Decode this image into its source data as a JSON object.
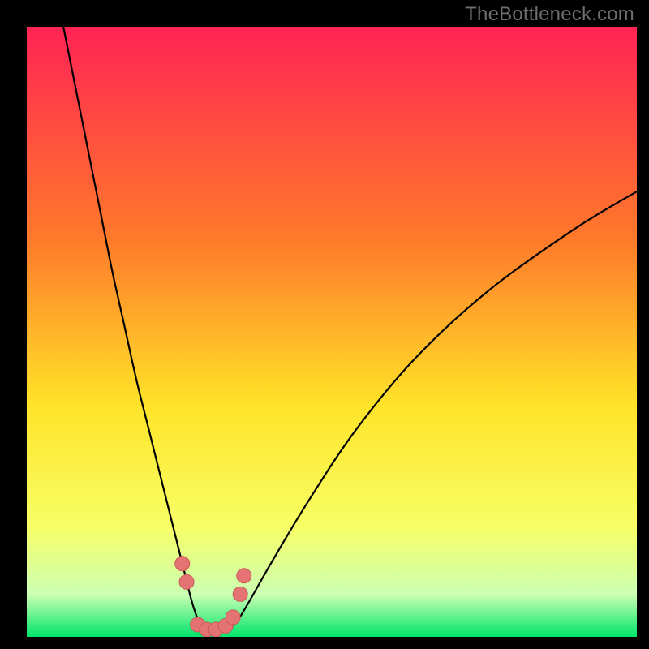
{
  "watermark": "TheBottleneck.com",
  "colors": {
    "frame": "#000000",
    "gradient_top": "#ff2355",
    "gradient_mid1": "#ff7a2a",
    "gradient_mid2": "#ffe328",
    "gradient_low": "#f7ff66",
    "gradient_pale": "#ccffb3",
    "gradient_bottom": "#00e56a",
    "curve": "#000000",
    "marker_fill": "#e57373",
    "marker_stroke": "#c85a5a"
  },
  "chart_data": {
    "type": "line",
    "title": "",
    "xlabel": "",
    "ylabel": "",
    "xlim": [
      0,
      100
    ],
    "ylim": [
      0,
      100
    ],
    "series": [
      {
        "name": "bottleneck-curve",
        "x": [
          6,
          8,
          10,
          12,
          14,
          16,
          18,
          20,
          22,
          24,
          26,
          27,
          28,
          29,
          30,
          31,
          32,
          34,
          36,
          40,
          46,
          54,
          64,
          76,
          90,
          100
        ],
        "y": [
          100,
          90,
          80,
          70,
          60,
          51,
          42,
          34,
          26,
          18,
          10,
          6,
          3,
          1.5,
          1,
          1,
          1.2,
          2,
          5,
          12,
          22,
          34,
          46,
          57,
          67,
          73
        ]
      }
    ],
    "markers": {
      "name": "highlight-dots",
      "x": [
        25.5,
        26.2,
        28.0,
        29.5,
        31.0,
        32.6,
        33.8,
        35.0,
        35.6
      ],
      "y": [
        12.0,
        9.0,
        2.0,
        1.2,
        1.2,
        1.8,
        3.2,
        7.0,
        10.0
      ]
    }
  }
}
